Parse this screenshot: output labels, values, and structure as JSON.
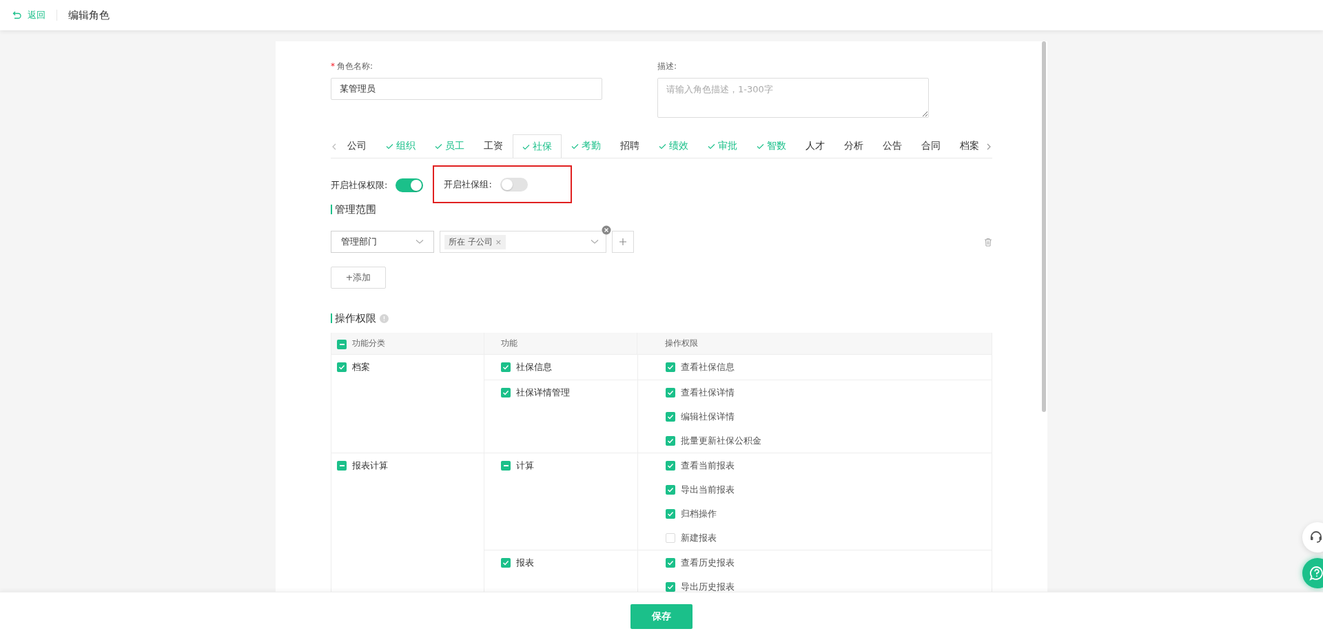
{
  "header": {
    "back": "返回",
    "title": "编辑角色"
  },
  "form": {
    "name_label": "角色名称:",
    "name_required_mark": "*",
    "name_value": "某管理员",
    "desc_label": "描述:",
    "desc_placeholder": "请输入角色描述，1-300字"
  },
  "tabs": [
    {
      "label": "公司",
      "checked": false,
      "selected": false
    },
    {
      "label": "组织",
      "checked": true,
      "selected": false
    },
    {
      "label": "员工",
      "checked": true,
      "selected": false
    },
    {
      "label": "工资",
      "checked": false,
      "selected": false
    },
    {
      "label": "社保",
      "checked": true,
      "selected": true
    },
    {
      "label": "考勤",
      "checked": true,
      "selected": false
    },
    {
      "label": "招聘",
      "checked": false,
      "selected": false
    },
    {
      "label": "绩效",
      "checked": true,
      "selected": false
    },
    {
      "label": "审批",
      "checked": true,
      "selected": false
    },
    {
      "label": "智数",
      "checked": true,
      "selected": false
    },
    {
      "label": "人才",
      "checked": false,
      "selected": false
    },
    {
      "label": "分析",
      "checked": false,
      "selected": false
    },
    {
      "label": "公告",
      "checked": false,
      "selected": false
    },
    {
      "label": "合同",
      "checked": false,
      "selected": false
    },
    {
      "label": "档案",
      "checked": false,
      "selected": false
    }
  ],
  "toggles": [
    {
      "label": "开启社保权限:",
      "on": true,
      "highlighted": false
    },
    {
      "label": "开启社保组:",
      "on": false,
      "highlighted": true
    }
  ],
  "scope": {
    "title": "管理范围",
    "type_select": "管理部门",
    "tags": [
      {
        "label": "所在 子公司",
        "remove": "×"
      }
    ],
    "add_button": "+添加"
  },
  "permissions": {
    "title": "操作权限",
    "columns": [
      {
        "label": "功能分类",
        "checked": true,
        "kind": "partial"
      },
      {
        "label": "功能"
      },
      {
        "label": "操作权限"
      }
    ],
    "categories": [
      {
        "label": "档案",
        "checked": true,
        "kind": "full",
        "functions": [
          {
            "label": "社保信息",
            "checked": true,
            "kind": "full",
            "actions": [
              {
                "label": "查看社保信息",
                "checked": true
              }
            ]
          },
          {
            "label": "社保详情管理",
            "checked": true,
            "kind": "full",
            "actions": [
              {
                "label": "查看社保详情",
                "checked": true
              },
              {
                "label": "编辑社保详情",
                "checked": true
              },
              {
                "label": "批量更新社保公积金",
                "checked": true
              }
            ]
          }
        ]
      },
      {
        "label": "报表计算",
        "checked": true,
        "kind": "partial",
        "functions": [
          {
            "label": "计算",
            "checked": true,
            "kind": "partial",
            "actions": [
              {
                "label": "查看当前报表",
                "checked": true
              },
              {
                "label": "导出当前报表",
                "checked": true
              },
              {
                "label": "归档操作",
                "checked": true
              },
              {
                "label": "新建报表",
                "checked": false
              }
            ]
          },
          {
            "label": "报表",
            "checked": true,
            "kind": "full",
            "actions": [
              {
                "label": "查看历史报表",
                "checked": true
              },
              {
                "label": "导出历史报表",
                "checked": true
              }
            ]
          }
        ]
      }
    ]
  },
  "footer": {
    "save": "保存"
  }
}
